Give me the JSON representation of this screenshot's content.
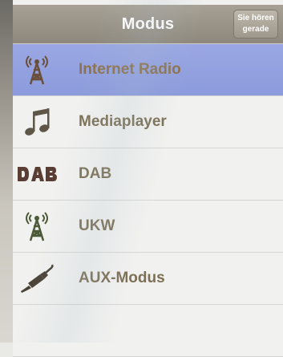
{
  "header": {
    "title": "Modus",
    "now_playing_line1": "Sie hören",
    "now_playing_line2": "gerade"
  },
  "list": {
    "items": [
      {
        "label": "Internet Radio",
        "icon": "radio-tower-icon",
        "selected": true
      },
      {
        "label": "Mediaplayer",
        "icon": "music-note-icon",
        "selected": false
      },
      {
        "label": "DAB",
        "icon": "dab-logo-icon",
        "selected": false
      },
      {
        "label": "UKW",
        "icon": "radio-tower-icon",
        "selected": false
      },
      {
        "label": "AUX-Modus",
        "icon": "aux-cable-icon",
        "selected": false
      }
    ]
  },
  "colors": {
    "header": "#9a9488",
    "selected_row": "#93a1e0",
    "label": "#7d7055",
    "icon": "#5e5646"
  }
}
